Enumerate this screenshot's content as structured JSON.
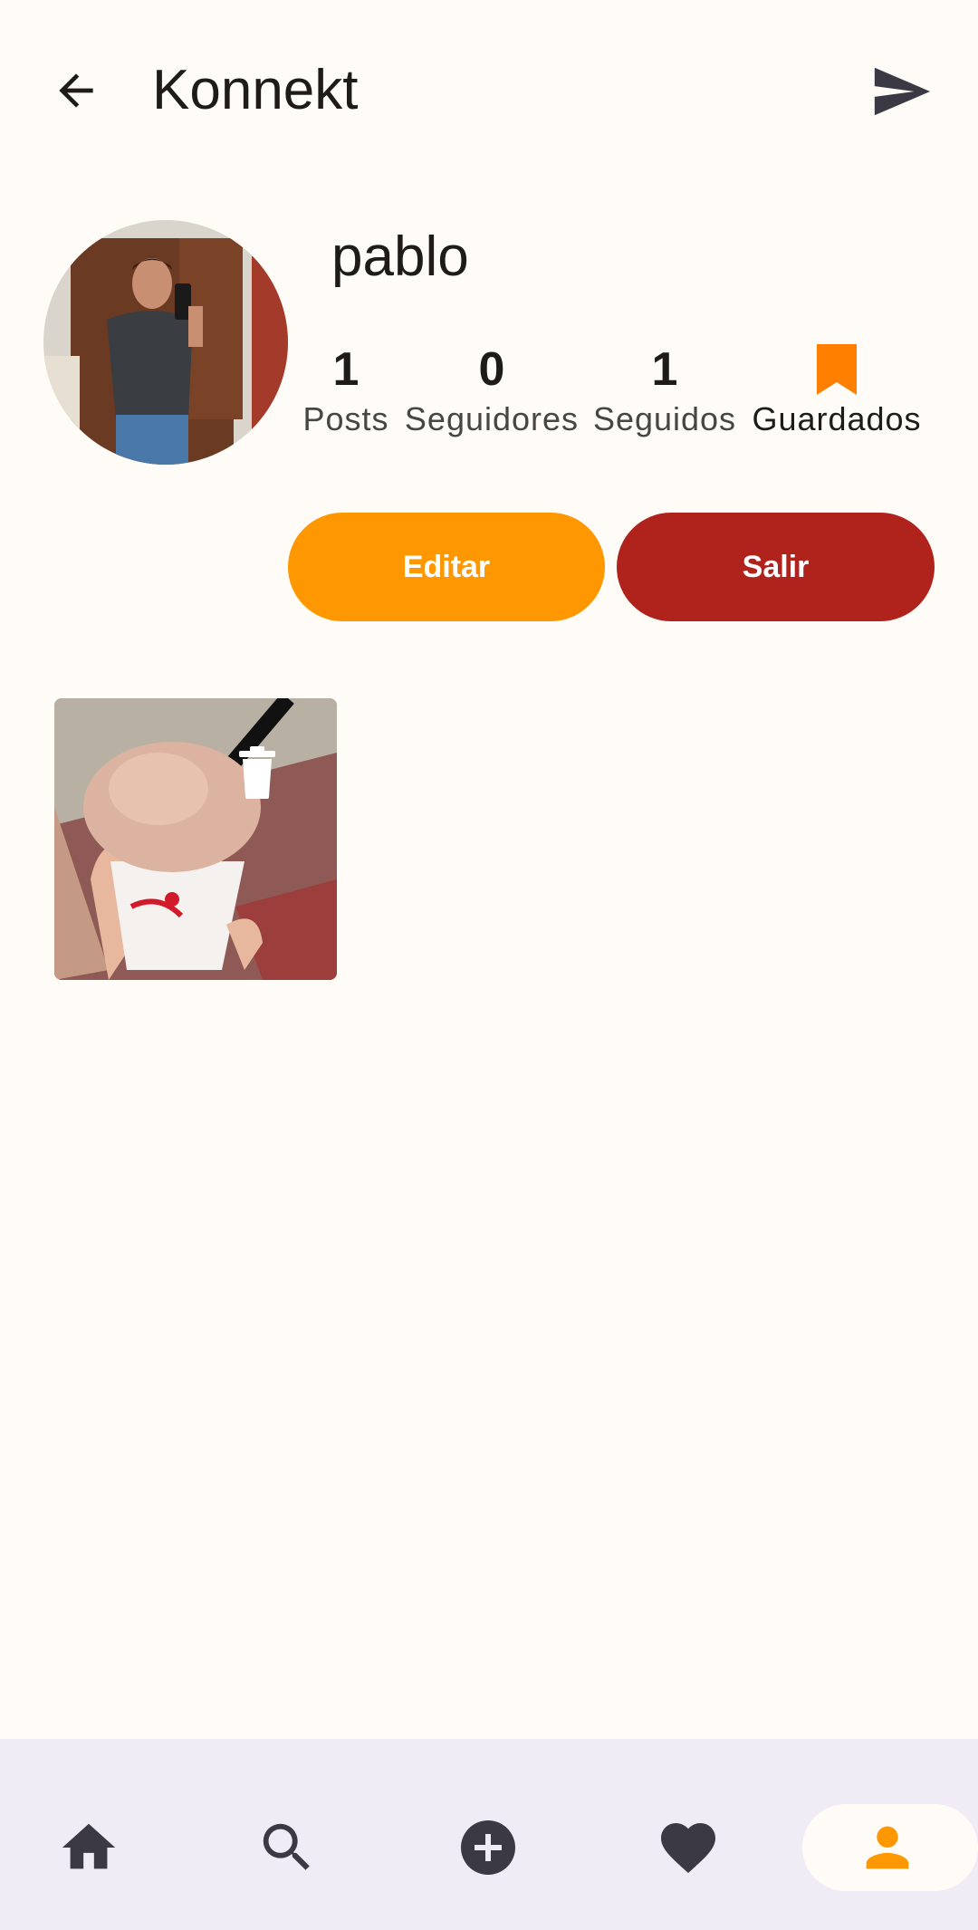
{
  "header": {
    "title": "Konnekt",
    "back_icon": "arrow-back-icon",
    "send_icon": "send-icon"
  },
  "profile": {
    "username": "pablo",
    "stats": [
      {
        "value": "1",
        "label": "Posts"
      },
      {
        "value": "0",
        "label": "Seguidores"
      },
      {
        "value": "1",
        "label": "Seguidos"
      }
    ],
    "saved": {
      "label": "Guardados",
      "icon": "bookmark-icon",
      "color": "#ff7f00"
    }
  },
  "actions": {
    "edit_label": "Editar",
    "exit_label": "Salir",
    "edit_color": "#ff9800",
    "exit_color": "#b0221c"
  },
  "posts": [
    {
      "delete_icon": "trash-icon"
    }
  ],
  "nav": {
    "items": [
      "home-icon",
      "search-icon",
      "add-circle-icon",
      "heart-icon",
      "person-icon"
    ],
    "active": "person-icon",
    "active_color": "#ff9800"
  }
}
